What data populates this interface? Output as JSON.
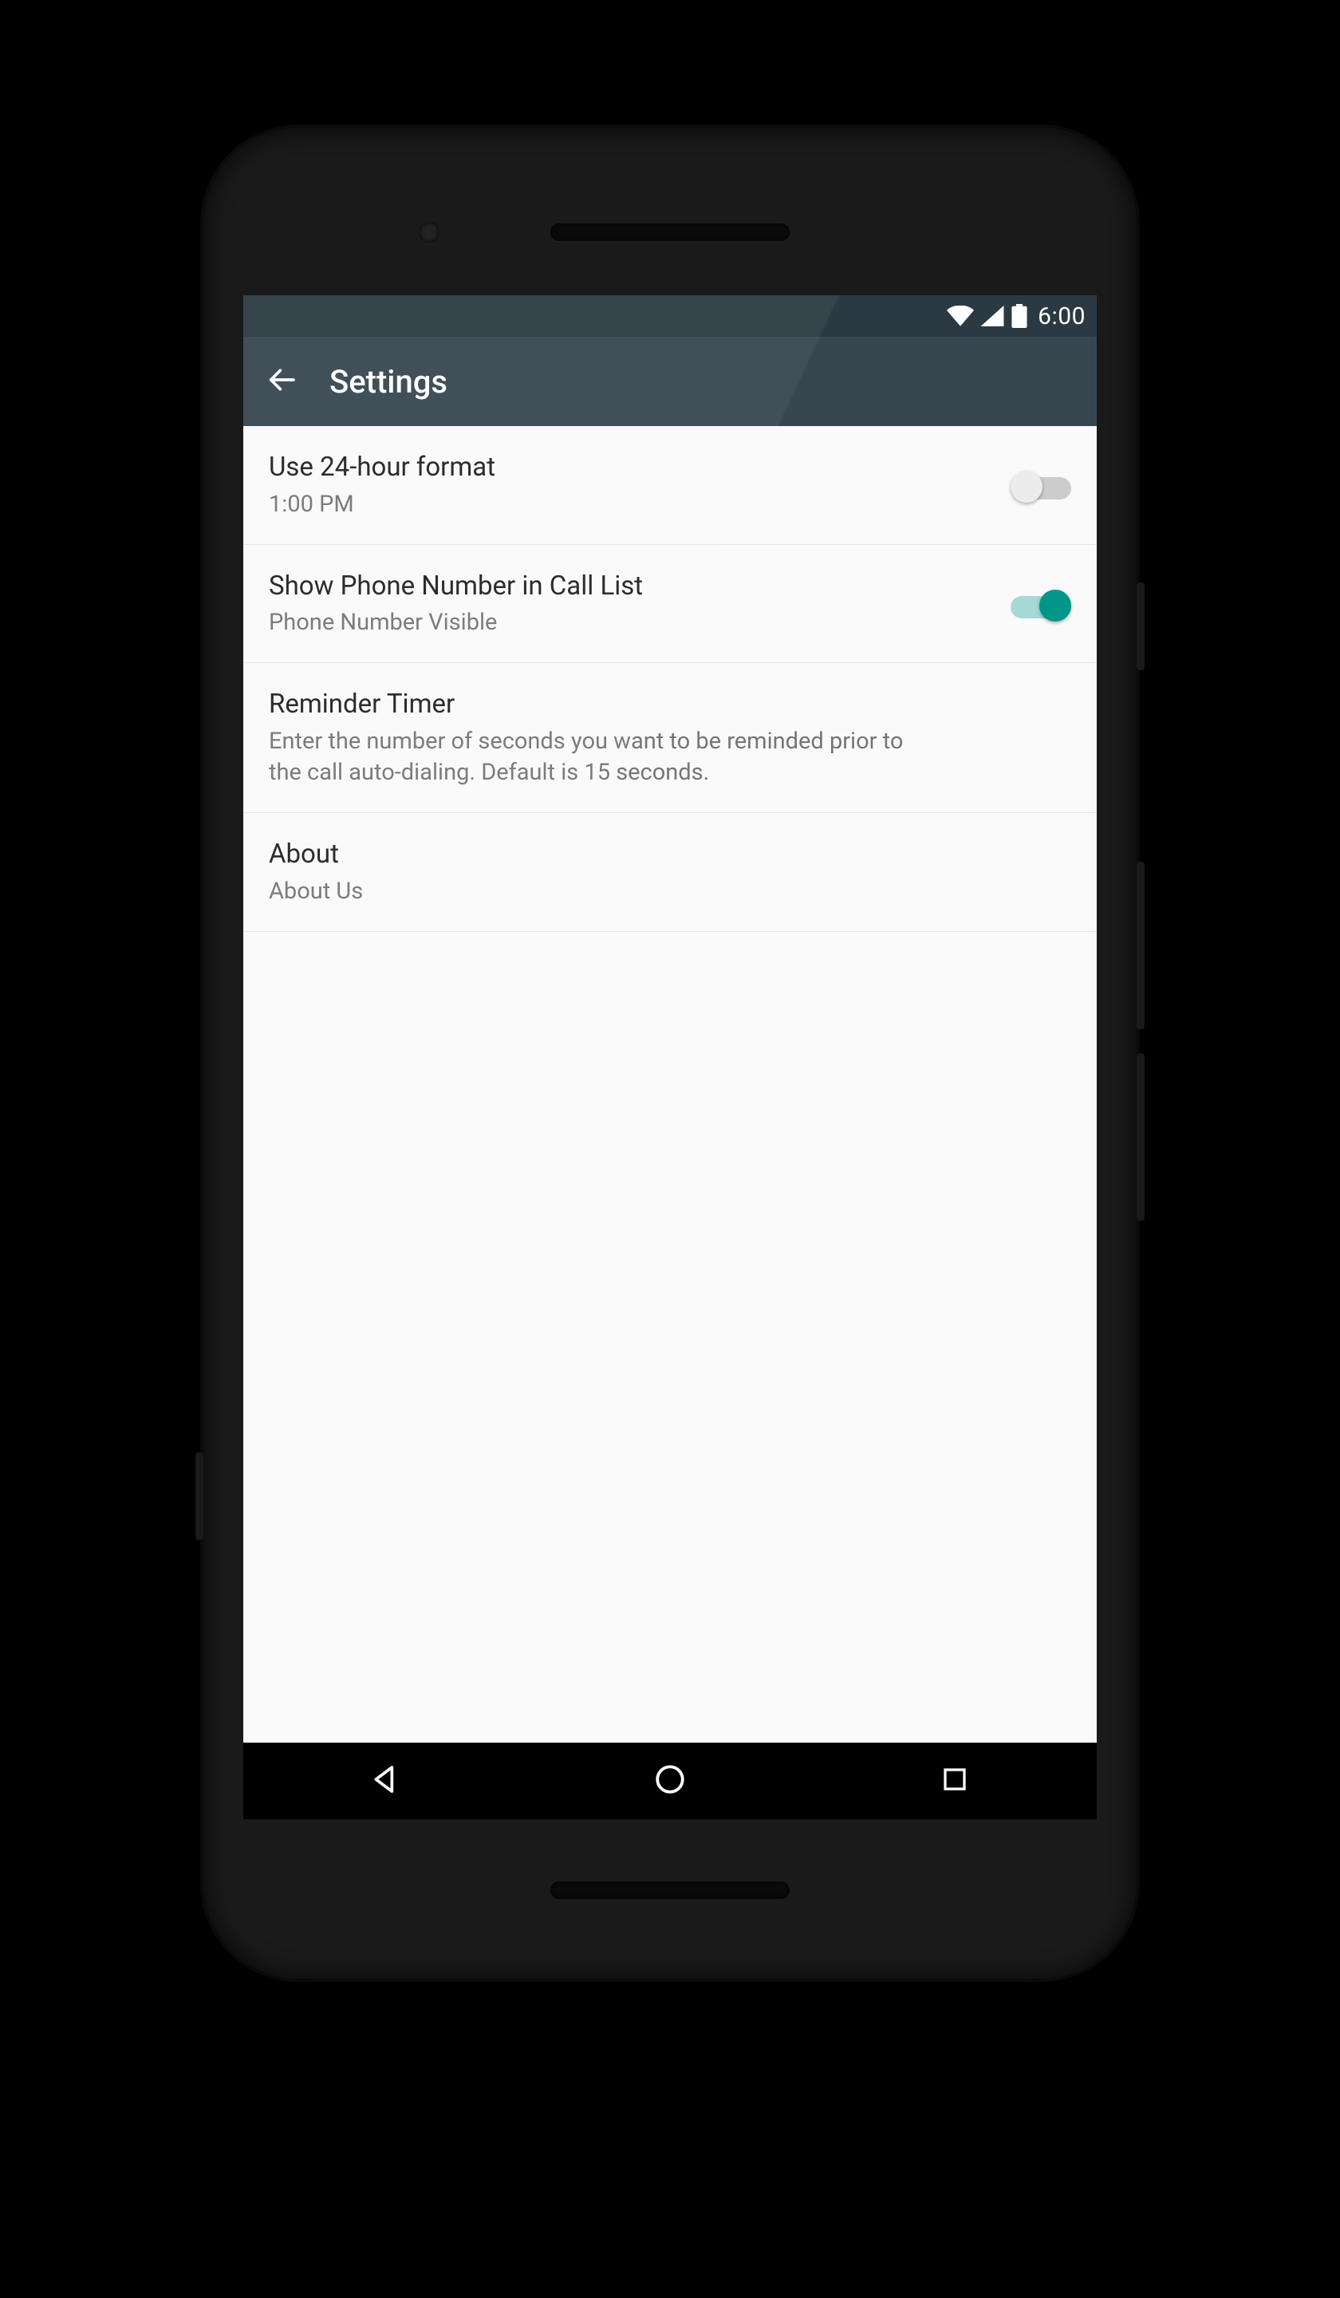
{
  "status": {
    "time": "6:00"
  },
  "appbar": {
    "title": "Settings"
  },
  "settings": {
    "items": [
      {
        "title": "Use 24-hour format",
        "sub": "1:00 PM",
        "switch": "off"
      },
      {
        "title": "Show Phone Number in Call List",
        "sub": "Phone Number Visible",
        "switch": "on"
      },
      {
        "title": "Reminder Timer",
        "sub": "Enter the number of seconds you want to be reminded prior to the call auto-dialing. Default is 15 seconds."
      },
      {
        "title": "About",
        "sub": "About Us"
      }
    ]
  },
  "colors": {
    "accent": "#009688",
    "appbar": "#37474f",
    "statusbar": "#2b3a42"
  }
}
